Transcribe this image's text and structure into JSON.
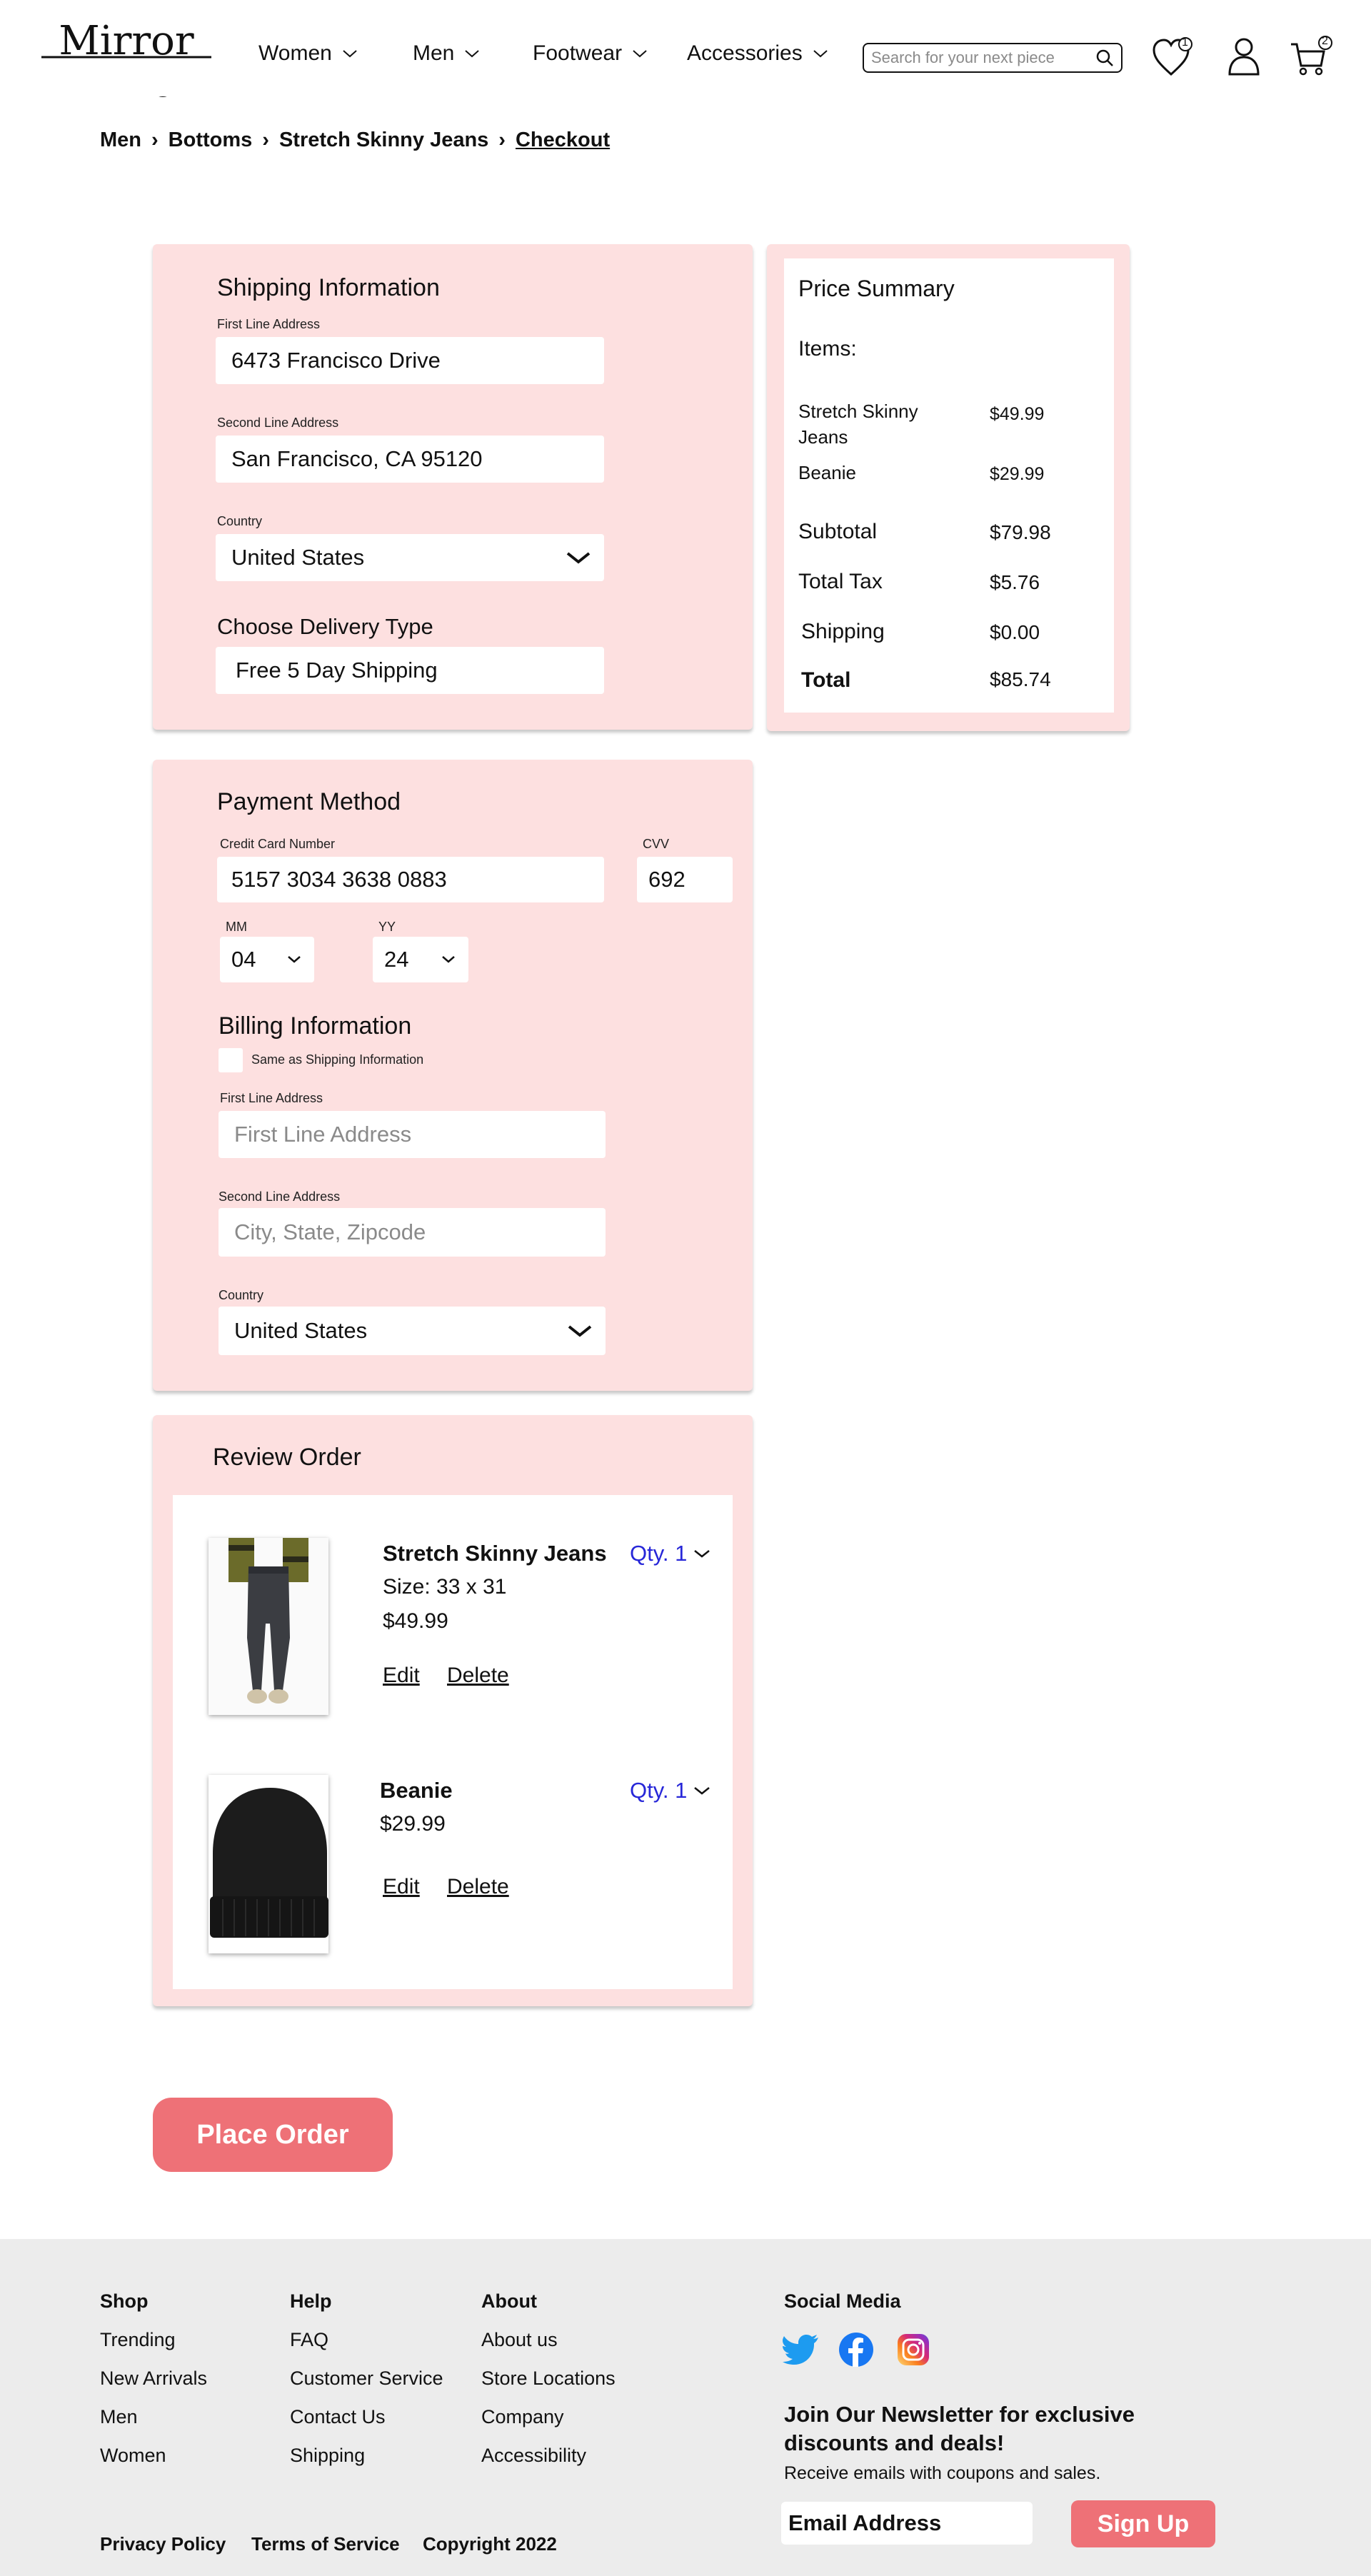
{
  "brand": {
    "logo_text": "Mirror"
  },
  "nav": {
    "items": [
      {
        "label": "Women"
      },
      {
        "label": "Men"
      },
      {
        "label": "Footwear"
      },
      {
        "label": "Accessories"
      }
    ]
  },
  "search": {
    "placeholder": "Search for your next piece"
  },
  "header_icons": {
    "wishlist_count": "1",
    "cart_count": "2"
  },
  "breadcrumb": [
    "Men",
    "Bottoms",
    "Stretch Skinny Jeans",
    "Checkout"
  ],
  "shipping": {
    "title": "Shipping Information",
    "line1_label": "First Line Address",
    "line1_value": "6473 Francisco Drive",
    "line2_label": "Second Line Address",
    "line2_value": "San Francisco, CA 95120",
    "country_label": "Country",
    "country_value": "United States",
    "delivery_title": "Choose Delivery Type",
    "delivery_value": "Free 5 Day Shipping"
  },
  "summary": {
    "title": "Price Summary",
    "items_label": "Items:",
    "items": [
      {
        "name": "Stretch Skinny Jeans",
        "price": "$49.99"
      },
      {
        "name": "Beanie",
        "price": "$29.99"
      }
    ],
    "subtotal_label": "Subtotal",
    "subtotal": "$79.98",
    "tax_label": "Total Tax",
    "tax": "$5.76",
    "shipping_label": "Shipping",
    "shipping": "$0.00",
    "total_label": "Total",
    "total": "$85.74"
  },
  "payment": {
    "title": "Payment Method",
    "card_label": "Credit Card Number",
    "card_value": "5157 3034 3638 0883",
    "cvv_label": "CVV",
    "cvv_value": "692",
    "mm_label": "MM",
    "mm_value": "04",
    "yy_label": "YY",
    "yy_value": "24",
    "billing_title": "Billing Information",
    "same_as_label": "Same as Shipping Information",
    "line1_label": "First Line Address",
    "line1_placeholder": "First Line Address",
    "line2_label": "Second Line Address",
    "line2_placeholder": "City, State, Zipcode",
    "country_label": "Country",
    "country_value": "United States"
  },
  "review": {
    "title": "Review Order",
    "items": [
      {
        "name": "Stretch Skinny Jeans",
        "size": "Size: 33 x 31",
        "price": "$49.99",
        "qty": "Qty. 1",
        "edit": "Edit",
        "delete": "Delete"
      },
      {
        "name": "Beanie",
        "price": "$29.99",
        "qty": "Qty. 1",
        "edit": "Edit",
        "delete": "Delete"
      }
    ]
  },
  "place_order": "Place Order",
  "footer": {
    "shop": {
      "title": "Shop",
      "links": [
        "Trending",
        "New Arrivals",
        "Men",
        "Women"
      ]
    },
    "help": {
      "title": "Help",
      "links": [
        "FAQ",
        "Customer Service",
        "Contact Us",
        "Shipping"
      ]
    },
    "about": {
      "title": "About",
      "links": [
        "About us",
        "Store Locations",
        "Company",
        "Accessibility"
      ]
    },
    "social_title": "Social Media",
    "newsletter_title": "Join Our Newsletter for exclusive discounts and deals!",
    "newsletter_sub": "Receive emails with coupons and sales.",
    "email_placeholder": "Email Address",
    "signup": "Sign Up",
    "bottom": [
      "Privacy Policy",
      "Terms of Service",
      "Copyright 2022"
    ]
  },
  "colors": {
    "panel_bg": "#fde0e0",
    "accent": "#ee7177",
    "qty_blue": "#2727d8",
    "footer_bg": "#ececec"
  }
}
